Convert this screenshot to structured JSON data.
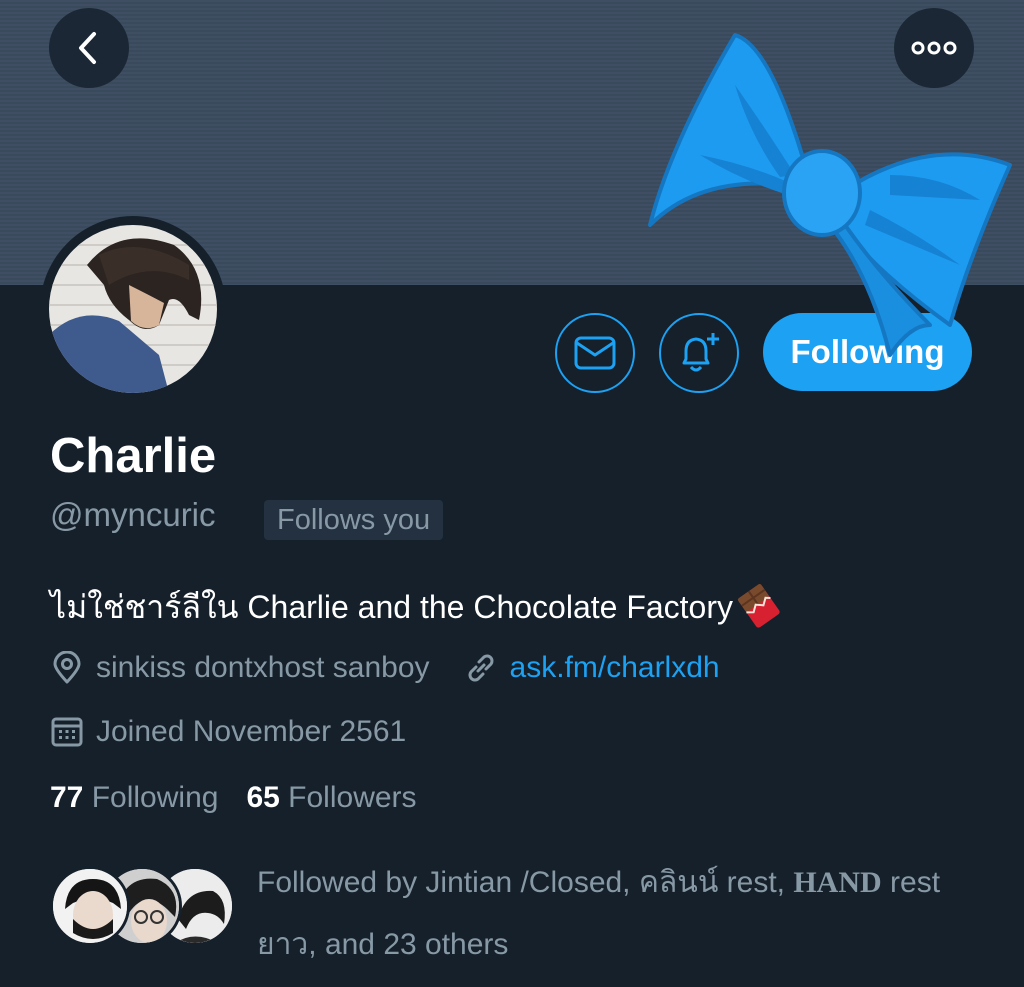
{
  "profile": {
    "name": "Charlie",
    "handle": "@myncuric",
    "follows_you": "Follows you",
    "bio": "ไม่ใช่ชาร์ลีใน Charlie and the Chocolate Factory",
    "location": "sinkiss dontxhost sanboy",
    "link": "ask.fm/charlxdh",
    "joined": "Joined November 2561"
  },
  "actions": {
    "following_label": "Following"
  },
  "stats": {
    "following_count": "77",
    "following_label": "Following",
    "followers_count": "65",
    "followers_label": "Followers"
  },
  "followed_by": {
    "prefix": "Followed by Jintian /Closed, คลินน์ rest, ",
    "hand": "HAND",
    "suffix": " rest ยาว, and 23 others"
  },
  "colors": {
    "accent": "#1da1f2",
    "background": "#15202b",
    "banner": "#3b4b5f",
    "secondary_text": "#8899a6"
  },
  "icons": [
    "back-arrow-icon",
    "more-icon",
    "envelope-icon",
    "bell-plus-icon",
    "location-pin-icon",
    "link-icon",
    "calendar-icon",
    "chocolate-icon",
    "bow-ribbon-icon"
  ]
}
